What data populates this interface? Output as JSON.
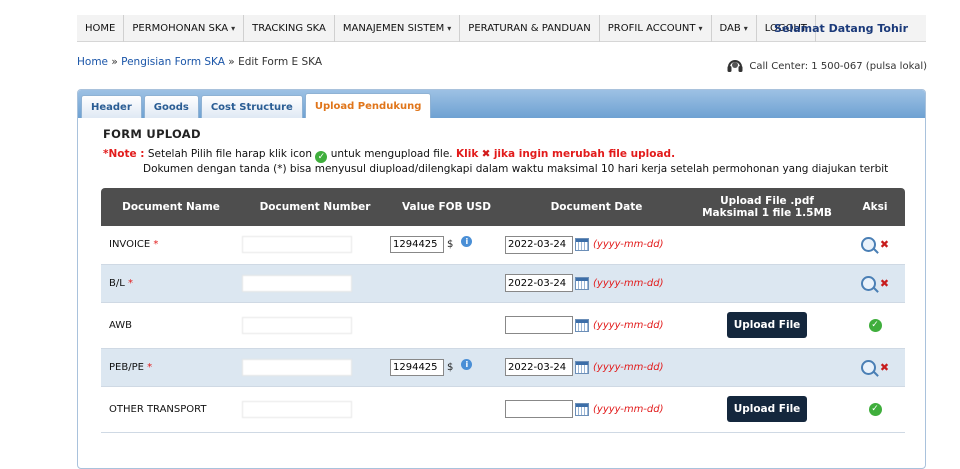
{
  "header": {
    "menu": [
      {
        "label": "HOME",
        "dropdown": false
      },
      {
        "label": "PERMOHONAN SKA",
        "dropdown": true
      },
      {
        "label": "TRACKING SKA",
        "dropdown": false
      },
      {
        "label": "MANAJEMEN SISTEM",
        "dropdown": true
      },
      {
        "label": "PERATURAN & PANDUAN",
        "dropdown": false
      },
      {
        "label": "PROFIL ACCOUNT",
        "dropdown": true
      },
      {
        "label": "DAB",
        "dropdown": true
      },
      {
        "label": "LOGOUT",
        "dropdown": false
      }
    ],
    "welcome": "Selamat Datang Tohir"
  },
  "breadcrumb": {
    "home": "Home",
    "sep": "»",
    "form": "Pengisian Form SKA",
    "current": "Edit Form E SKA"
  },
  "callcenter": "Call Center: 1 500-067 (pulsa lokal)",
  "tabs": [
    {
      "label": "Header",
      "active": false
    },
    {
      "label": "Goods",
      "active": false
    },
    {
      "label": "Cost Structure",
      "active": false
    },
    {
      "label": "Upload Pendukung",
      "active": true
    }
  ],
  "form": {
    "title": "FORM UPLOAD",
    "note_label": "*Note :",
    "note_text1": "Setelah Pilih file harap klik icon",
    "note_text2": "untuk mengupload file.",
    "note_red1": "Klik",
    "note_red2": "jika ingin merubah file upload.",
    "note_line2": "Dokumen dengan tanda (*) bisa menyusul diupload/dilengkapi dalam waktu maksimal 10 hari kerja setelah permohonan yang diajukan terbit"
  },
  "table": {
    "headers": {
      "name": "Document Name",
      "number": "Document Number",
      "fob": "Value FOB USD",
      "date": "Document Date",
      "upload_line1": "Upload File .pdf",
      "upload_line2": "Maksimal 1 file 1.5MB",
      "aksi": "Aksi"
    },
    "currency": "$",
    "date_hint": "(yyyy-mm-dd)",
    "upload_label": "Upload File",
    "rows": [
      {
        "name": "INVOICE",
        "req": "*",
        "number": "",
        "fob": "1294425",
        "date": "2022-03-24",
        "uploaded": true
      },
      {
        "name": "B/L",
        "req": "*",
        "number": "",
        "fob": "",
        "date": "2022-03-24",
        "uploaded": true
      },
      {
        "name": "AWB",
        "req": "",
        "number": "",
        "fob": "",
        "date": "",
        "uploaded": false
      },
      {
        "name": "PEB/PE",
        "req": "*",
        "number": "",
        "fob": "1294425",
        "date": "2022-03-24",
        "uploaded": true
      },
      {
        "name": "OTHER TRANSPORT",
        "req": "",
        "number": "",
        "fob": "",
        "date": "",
        "uploaded": false
      }
    ]
  }
}
